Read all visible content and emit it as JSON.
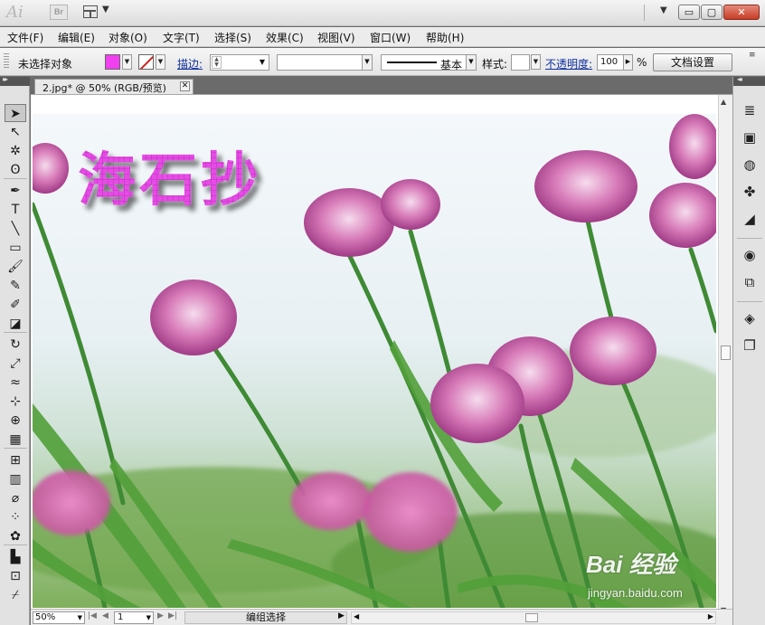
{
  "titlebar": {
    "app_logo": "Ai",
    "bridge_label": "Br",
    "arrange_arrow": "▼",
    "workspace_arrow": "▼",
    "minimize": "▭",
    "maximize": "▢",
    "close": "✕"
  },
  "menus": [
    "文件(F)",
    "编辑(E)",
    "对象(O)",
    "文字(T)",
    "选择(S)",
    "效果(C)",
    "视图(V)",
    "窗口(W)",
    "帮助(H)"
  ],
  "control": {
    "selection_status": "未选择对象",
    "fill_color": "#f040f0",
    "stroke_label": "描边:",
    "stroke_weight": "",
    "brush_label": "基本",
    "style_label": "样式:",
    "opacity_label": "不透明度:",
    "opacity_value": "100",
    "opacity_unit": "%",
    "doc_setup_label": "文档设置",
    "panel_menu": "≡"
  },
  "document": {
    "tab_title": "2.jpg* @ 50% (RGB/预览)",
    "tab_close": "✕",
    "artwork_text": "海石抄",
    "artwork_text_color": "#e040e0"
  },
  "tools": [
    {
      "name": "selection-tool",
      "glyph": "➤",
      "active": true
    },
    {
      "name": "direct-selection-tool",
      "glyph": "↖"
    },
    {
      "name": "magic-wand-tool",
      "glyph": "✲"
    },
    {
      "name": "lasso-tool",
      "glyph": "ʘ"
    },
    {
      "name": "pen-tool",
      "glyph": "✒"
    },
    {
      "name": "type-tool",
      "glyph": "T"
    },
    {
      "name": "line-segment-tool",
      "glyph": "╲"
    },
    {
      "name": "rectangle-tool",
      "glyph": "▭"
    },
    {
      "name": "paintbrush-tool",
      "glyph": "🖌"
    },
    {
      "name": "pencil-tool",
      "glyph": "✎"
    },
    {
      "name": "blob-brush-tool",
      "glyph": "✐"
    },
    {
      "name": "eraser-tool",
      "glyph": "◪"
    },
    {
      "name": "rotate-tool",
      "glyph": "↻"
    },
    {
      "name": "scale-tool",
      "glyph": "⤢"
    },
    {
      "name": "warp-tool",
      "glyph": "≈"
    },
    {
      "name": "free-transform-tool",
      "glyph": "⊹"
    },
    {
      "name": "shape-builder-tool",
      "glyph": "⊕"
    },
    {
      "name": "perspective-grid-tool",
      "glyph": "▦"
    },
    {
      "name": "mesh-tool",
      "glyph": "⊞"
    },
    {
      "name": "gradient-tool",
      "glyph": "▥"
    },
    {
      "name": "eyedropper-tool",
      "glyph": "⌀"
    },
    {
      "name": "blend-tool",
      "glyph": "⁘"
    },
    {
      "name": "symbol-sprayer-tool",
      "glyph": "✿"
    },
    {
      "name": "column-graph-tool",
      "glyph": "▙"
    },
    {
      "name": "artboard-tool",
      "glyph": "⊡"
    },
    {
      "name": "slice-tool",
      "glyph": "⌿"
    }
  ],
  "dock": [
    {
      "name": "color-panel-icon",
      "glyph": "≣"
    },
    {
      "name": "swatches-panel-icon",
      "glyph": "▣"
    },
    {
      "name": "brushes-panel-icon",
      "glyph": "◍"
    },
    {
      "name": "symbols-panel-icon",
      "glyph": "✤"
    },
    {
      "name": "graphic-styles-panel-icon",
      "glyph": "◢"
    },
    {
      "name": "appearance-panel-icon",
      "glyph": "◉"
    },
    {
      "name": "transform-panel-icon",
      "glyph": "⧉"
    },
    {
      "name": "layers-panel-icon",
      "glyph": "◈"
    },
    {
      "name": "artboards-panel-icon",
      "glyph": "❐"
    }
  ],
  "statusbar": {
    "zoom": "50%",
    "page": "1",
    "status_text": "编组选择",
    "nav_first": "|◀",
    "nav_prev": "◀",
    "nav_next": "▶",
    "nav_last": "▶|",
    "status_arrow": "▶"
  },
  "watermark": {
    "brand": "Bai 经验",
    "url": "jingyan.baidu.com"
  }
}
